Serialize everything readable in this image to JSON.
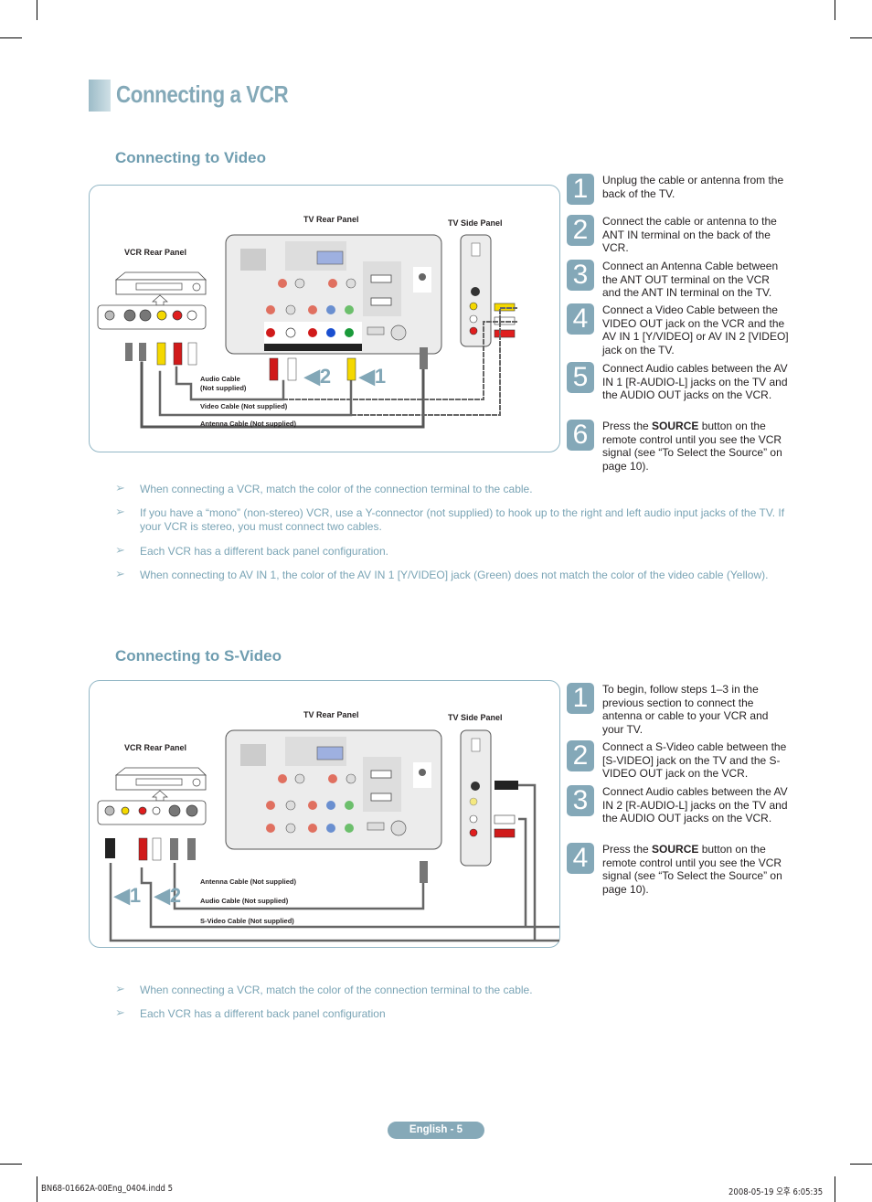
{
  "page": {
    "title": "Connecting a VCR",
    "page_badge": "English - 5",
    "footer_left": "BN68-01662A-00Eng_0404.indd   5",
    "footer_right": "2008-05-19   오후 6:05:35",
    "accent_color": "#84a8b8"
  },
  "video_section": {
    "title": "Connecting to Video",
    "diagram": {
      "tv_rear_label": "TV Rear Panel",
      "tv_side_label": "TV Side Panel",
      "vcr_rear_label": "VCR Rear Panel",
      "audio_cable_label_line1": "Audio Cable",
      "audio_cable_label_line2": "(Not supplied)",
      "video_cable_label": "Video Cable (Not supplied)",
      "antenna_cable_label": "Antenna Cable (Not supplied)",
      "marker_2": "2",
      "marker_1": "1"
    },
    "steps": [
      {
        "number": "1",
        "text": "Unplug the cable or antenna from the back of the TV."
      },
      {
        "number": "2",
        "text": "Connect the cable or antenna to the ANT IN terminal on the back of the VCR."
      },
      {
        "number": "3",
        "text": "Connect an Antenna Cable between the ANT OUT terminal on the VCR and the ANT IN terminal on the TV."
      },
      {
        "number": "4",
        "text": "Connect a Video Cable between the VIDEO OUT jack on the VCR and the AV IN 1 [Y/VIDEO] or AV IN 2 [VIDEO] jack on the TV."
      },
      {
        "number": "5",
        "text": "Connect Audio cables between the AV IN 1 [R-AUDIO-L] jacks on the TV and the AUDIO OUT jacks on the VCR."
      },
      {
        "number": "6",
        "text_before": "Press the ",
        "text_bold": "SOURCE",
        "text_after": " button on the remote control until you see the VCR signal (see “To Select the Source” on page 10)."
      }
    ],
    "notes": [
      "When connecting a VCR, match the color of the connection terminal to the cable.",
      "If you have a “mono” (non-stereo) VCR, use a Y-connector (not supplied) to hook up to the right and left audio input jacks of the TV. If your VCR is stereo, you must connect two cables.",
      "Each VCR has a different back panel configuration.",
      "When connecting to AV IN 1, the color of the AV IN 1 [Y/VIDEO] jack (Green) does not match the color of the video cable (Yellow)."
    ]
  },
  "svideo_section": {
    "title": "Connecting to S-Video",
    "diagram": {
      "tv_rear_label": "TV Rear Panel",
      "tv_side_label": "TV Side Panel",
      "vcr_rear_label": "VCR Rear Panel",
      "antenna_cable_label": "Antenna Cable (Not supplied)",
      "audio_cable_label": "Audio Cable (Not supplied)",
      "svideo_cable_label": "S-Video Cable (Not supplied)",
      "marker_1": "1",
      "marker_2": "2"
    },
    "steps": [
      {
        "number": "1",
        "text": "To begin, follow steps 1–3 in the previous section to connect the antenna or cable to your VCR and your TV."
      },
      {
        "number": "2",
        "text": "Connect a S-Video cable between the [S-VIDEO] jack on the TV and the S-VIDEO OUT jack on the VCR."
      },
      {
        "number": "3",
        "text": "Connect Audio cables between the AV IN 2 [R-AUDIO-L] jacks on the TV and the AUDIO OUT jacks on the VCR."
      },
      {
        "number": "4",
        "text_before": "Press the ",
        "text_bold": "SOURCE",
        "text_after": " button on the remote control until you see the VCR signal (see “To Select the Source” on page 10)."
      }
    ],
    "notes": [
      "When connecting a VCR, match the color of the connection terminal to the cable.",
      "Each VCR has a different back panel configuration"
    ]
  },
  "note_arrow_icon": "➢"
}
